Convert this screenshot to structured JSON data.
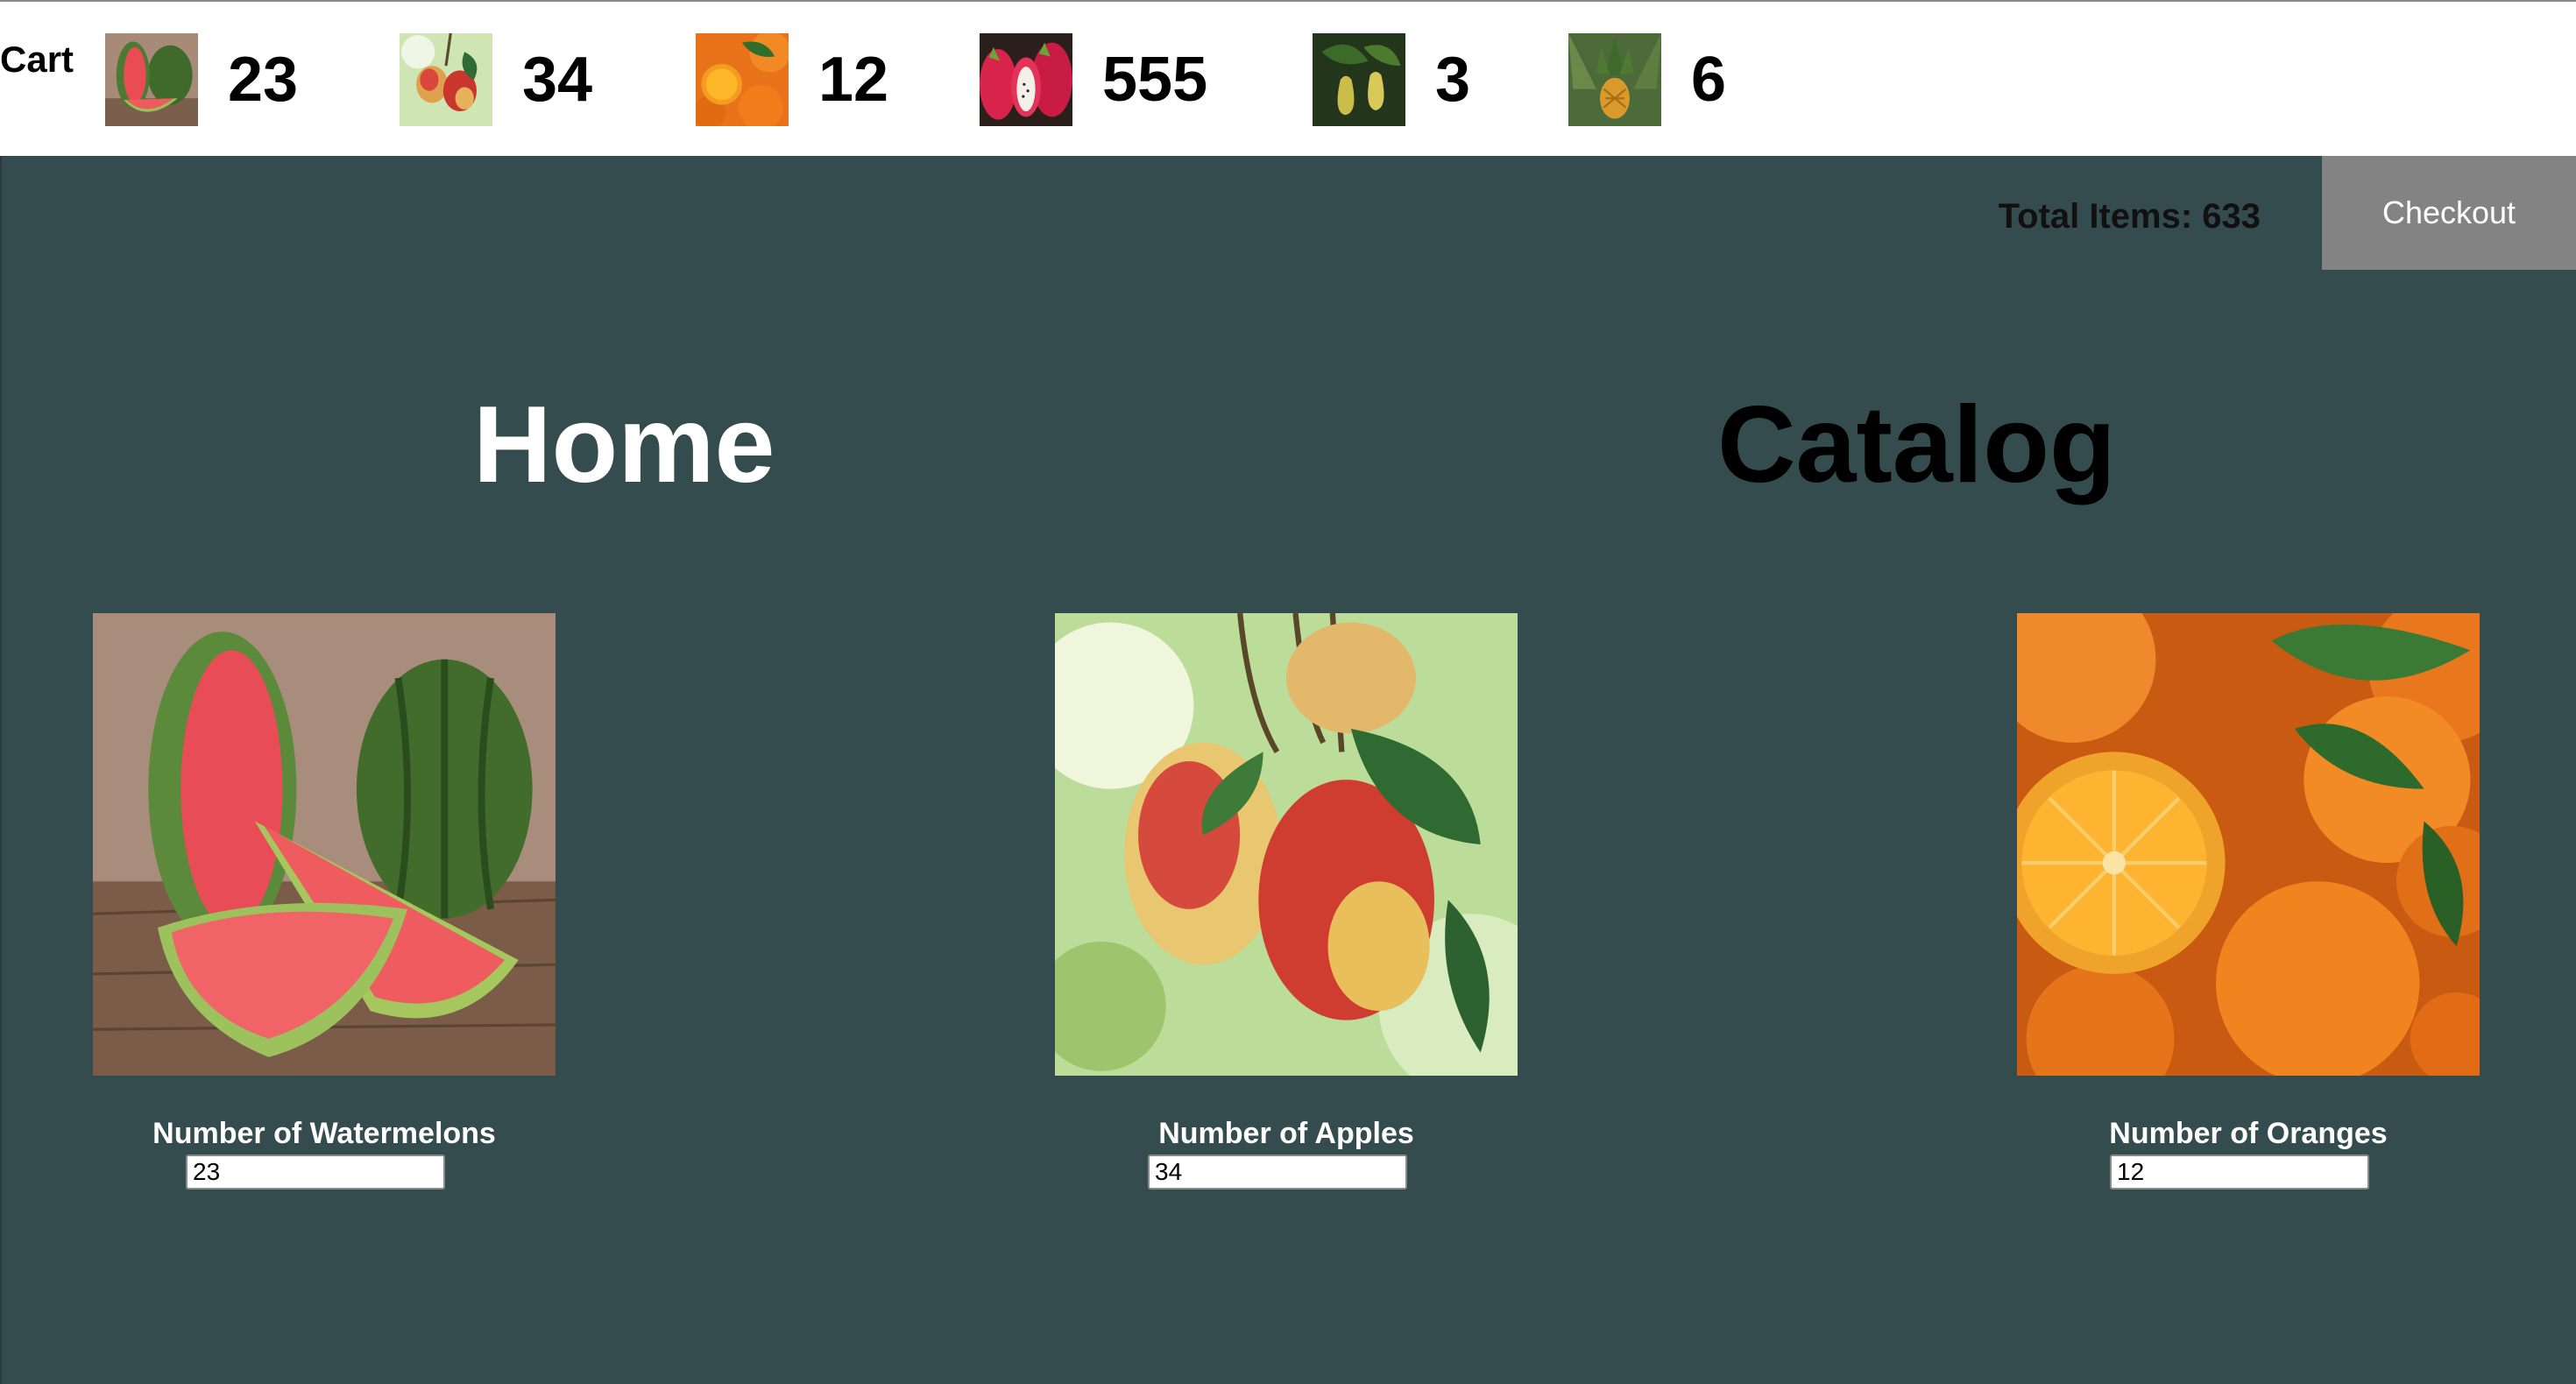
{
  "cart": {
    "label": "Cart",
    "items": [
      {
        "fruit": "watermelon",
        "icon": "watermelon-thumbnail",
        "count": "23"
      },
      {
        "fruit": "apple",
        "icon": "apple-thumbnail",
        "count": "34"
      },
      {
        "fruit": "orange",
        "icon": "orange-thumbnail",
        "count": "12"
      },
      {
        "fruit": "dragon fruit",
        "icon": "dragonfruit-thumbnail",
        "count": "555"
      },
      {
        "fruit": "pear",
        "icon": "pear-thumbnail",
        "count": "3"
      },
      {
        "fruit": "pineapple",
        "icon": "pineapple-thumbnail",
        "count": "6"
      }
    ]
  },
  "header": {
    "total_items": "Total Items: 633",
    "checkout_label": "Checkout"
  },
  "nav": {
    "home": "Home",
    "catalog": "Catalog"
  },
  "products": [
    {
      "image": "watermelon-photo",
      "label": "Number of Watermelons",
      "value": "23"
    },
    {
      "image": "apple-photo",
      "label": "Number of Apples",
      "value": "34"
    },
    {
      "image": "orange-photo",
      "label": "Number of Oranges",
      "value": "12"
    }
  ],
  "colors": {
    "panel_background": "#354c4f",
    "checkout_background": "#838383",
    "home_link": "#ffffff",
    "catalog_link": "#000000"
  }
}
